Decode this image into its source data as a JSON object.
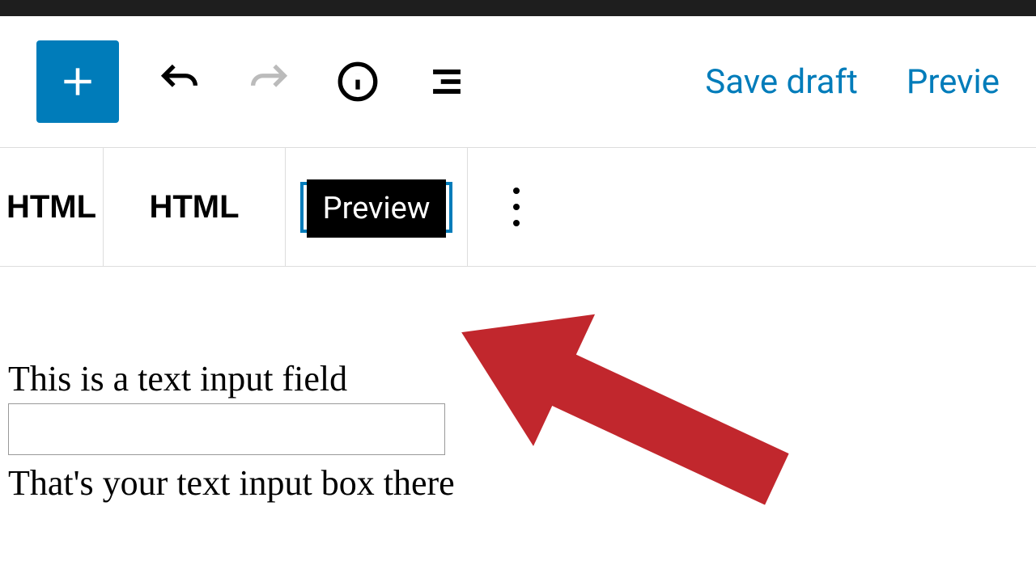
{
  "toolbar": {
    "add_label": "Add block",
    "undo_label": "Undo",
    "redo_label": "Redo",
    "info_label": "Details",
    "outline_label": "Outline",
    "save_draft": "Save draft",
    "preview": "Previe"
  },
  "block_toolbar": {
    "block_type_short": "HTML",
    "html_tab": "HTML",
    "preview_tab": "Preview",
    "more_label": "More options"
  },
  "content": {
    "label_above": "This is a text input field",
    "label_below": "That's your text input box there",
    "input_value": ""
  },
  "annotation": {
    "arrow_color": "#c1272d"
  }
}
